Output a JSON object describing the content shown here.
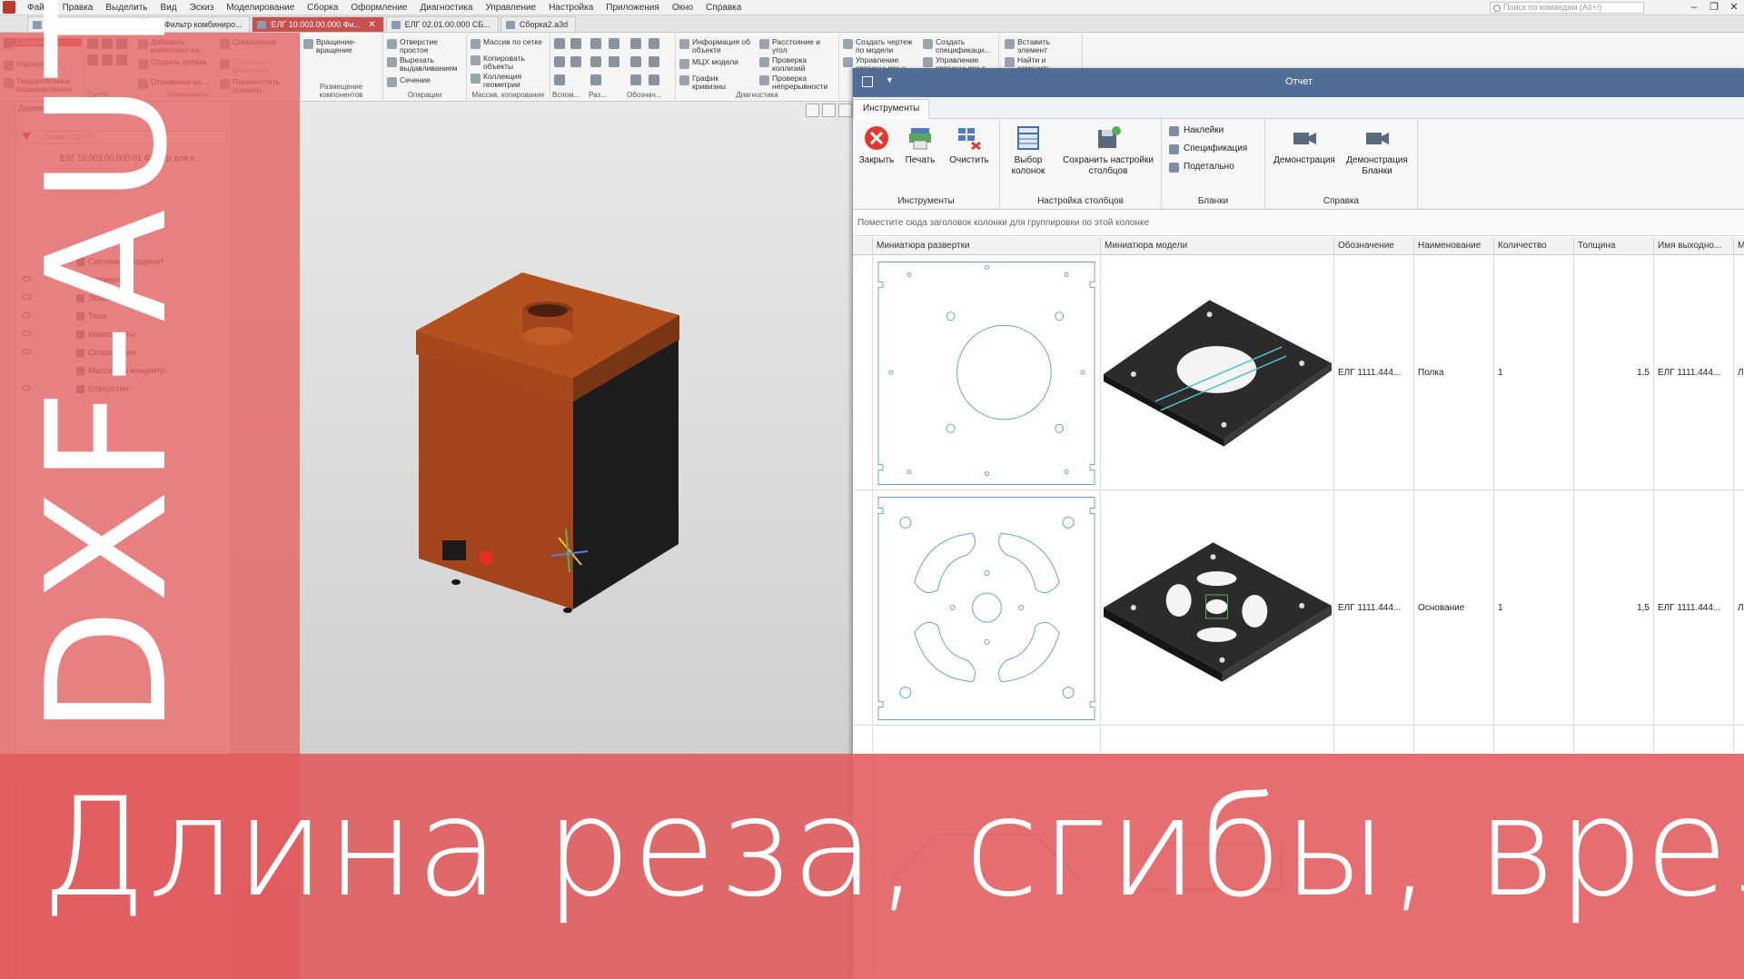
{
  "menubar": {
    "items": [
      "Файл",
      "Правка",
      "Выделить",
      "Вид",
      "Эскиз",
      "Моделирование",
      "Сборка",
      "Оформление",
      "Диагностика",
      "Управление",
      "Настройка",
      "Приложения",
      "Окно",
      "Справка"
    ],
    "search_placeholder": "Поиск по командам (Alt+/)"
  },
  "tabs": [
    {
      "label": "ЕЛГ 10.003.00.401 Дн..."
    },
    {
      "label": "Фильтр комбиниро..."
    },
    {
      "label": "ЕЛГ 10.003.00.000 Фи..."
    },
    {
      "label": "ЕЛГ 02.01.00.000 СБ..."
    },
    {
      "label": "Сборка2.a3d"
    }
  ],
  "ribbon": {
    "left_tabs": [
      "Сборка",
      "Управление",
      "Твердотельное моделирование"
    ],
    "buttons": {
      "add_component": "Добавить компонент из...",
      "create_part": "Создать деталь",
      "coincidence": "Совпадение",
      "rotation": "Вращение-вращение",
      "disable_fix": "Отключить фиксацию",
      "reflection": "Отражение ко...",
      "move_element": "Переместить элемент",
      "hole_simple": "Отверстие простое",
      "cut_extrude": "Вырезать выдавливанием",
      "section": "Сечение",
      "array_grid": "Массив по сетке",
      "copy_objects": "Копировать объекты",
      "geometry_collection": "Коллекция геометрии",
      "object_info": "Информация об объекте",
      "mcx_model": "МЦХ модели",
      "curvature_graph": "График кривизны",
      "distance_angle": "Расстояние и угол",
      "collision_check": "Проверка коллизий",
      "continuity_check": "Проверка непрерывности",
      "create_drawing": "Создать чертеж по модели",
      "manage_linked": "Управление связанными ч...",
      "create_spec": "Создать спецификаци...",
      "manage_linked_s": "Управление связанными с...",
      "insert_element": "Вставить элемент",
      "find_replace": "Найти и заменить"
    },
    "group_labels": {
      "components": "Компоненты",
      "system": "Систе...",
      "placement": "Размещение компонентов",
      "operations": "Операции",
      "arrays": "Массив, копирование",
      "aux": "Вспом...",
      "size": "Раз...",
      "notation": "Обознач...",
      "diagnostics": "Диагностика"
    }
  },
  "tree": {
    "title": "Дерево: структура",
    "search_placeholder": "Поиск (Ctrl+F)",
    "root": "ЕЛГ 10.003.00.000-01 Фильтр для п...",
    "items": [
      "Системы координат",
      "Элементы",
      "Эскизы",
      "Тела",
      "Компоненты",
      "Сопряжения",
      "Массив по концентр...",
      "Отверстия"
    ]
  },
  "report": {
    "title": "Отчет",
    "tab": "Инструменты",
    "buttons": {
      "close": "Закрыть",
      "print": "Печать",
      "clear": "Очистить",
      "choose_columns": "Выбор колонок",
      "save_columns": "Сохранить настройки столбцов",
      "stickers": "Наклейки",
      "specification": "Спецификация",
      "per_part": "Подетально",
      "demo": "Демонстрация",
      "demo_forms": "Демонстрация Бланки"
    },
    "groups": {
      "tools": "Инструменты",
      "column_settings": "Настройка столбцов",
      "forms": "Бланки",
      "help": "Справка"
    },
    "group_hint": "Поместите сюда заголовок колонки для группировки по этой колонке",
    "columns": [
      "Миниатюра развертки",
      "Миниатюра модели",
      "Обозначение",
      "Наименование",
      "Количество",
      "Толщина",
      "Имя выходно...",
      "М"
    ],
    "rows": [
      {
        "designation": "ЕЛГ 1111.444...",
        "name": "Полка",
        "qty": "1",
        "thickness": "1,5",
        "output": "ЕЛГ 1111.444...",
        "extra": "Л"
      },
      {
        "designation": "ЕЛГ 1111.444...",
        "name": "Основание",
        "qty": "1",
        "thickness": "1,5",
        "output": "ЕЛГ 1111.444...",
        "extra": "Л"
      }
    ]
  },
  "overlay": {
    "vertical_title": "DXF-AUTO",
    "bottom_title": "Длина реза, сгибы, врезка"
  },
  "colors": {
    "overlay_red": "#e05a5a",
    "report_header": "#516d96",
    "model_brown": "#a7451d"
  }
}
